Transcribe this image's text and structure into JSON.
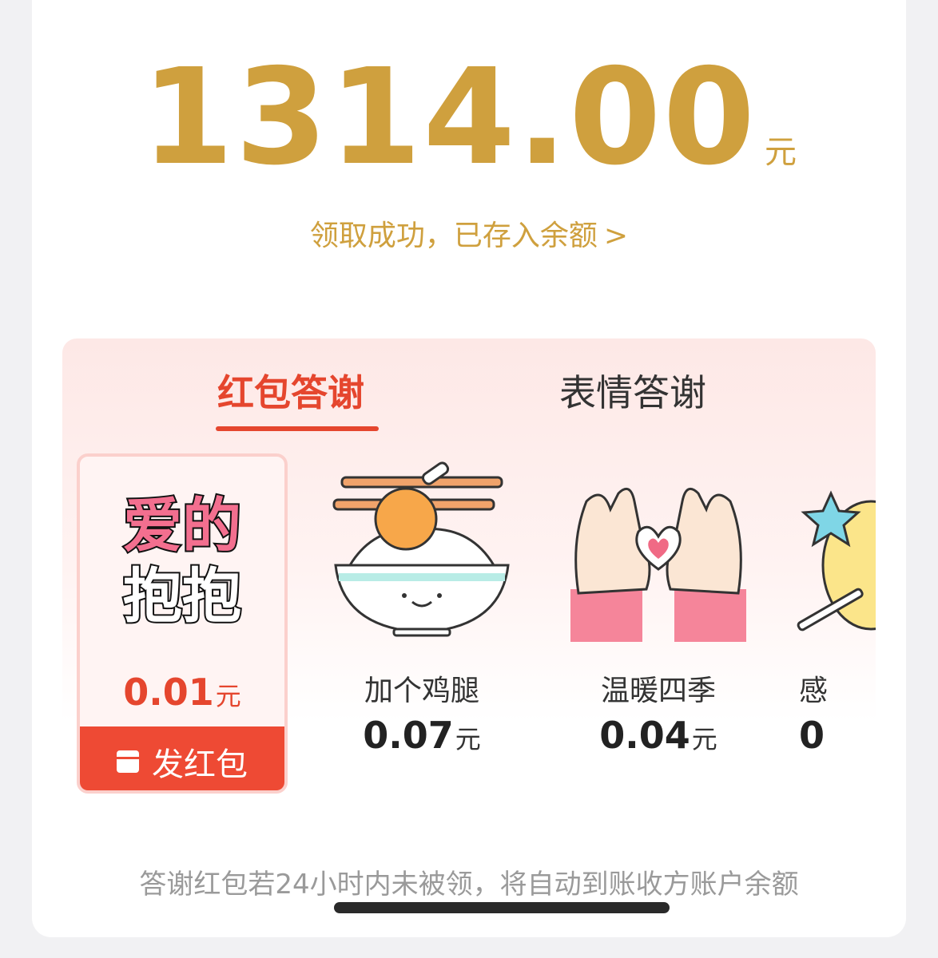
{
  "header": {
    "amount": "1314.00",
    "amount_unit": "元",
    "status_text": "领取成功，已存入余额",
    "status_chevron": ">"
  },
  "tabs": [
    {
      "label": "红包答谢",
      "active": true
    },
    {
      "label": "表情答谢",
      "active": false
    }
  ],
  "gift_card": {
    "sticker_text_line1": "爱的",
    "sticker_text_line2": "抱抱",
    "price": "0.01",
    "unit": "元",
    "send_button_label": "发红包"
  },
  "items": [
    {
      "label": "加个鸡腿",
      "price": "0.07",
      "unit": "元",
      "icon": "rice-bowl-chicken-icon"
    },
    {
      "label": "温暖四季",
      "price": "0.04",
      "unit": "元",
      "icon": "heart-hands-icon"
    },
    {
      "label": "感",
      "price": "0",
      "unit": "",
      "icon": "star-wand-icon"
    }
  ],
  "footnote": "答谢红包若24小时内未被领，将自动到账收方账户余额",
  "colors": {
    "gold": "#cfa03e",
    "accent_red": "#e5462e",
    "button_red": "#ee4a34"
  }
}
